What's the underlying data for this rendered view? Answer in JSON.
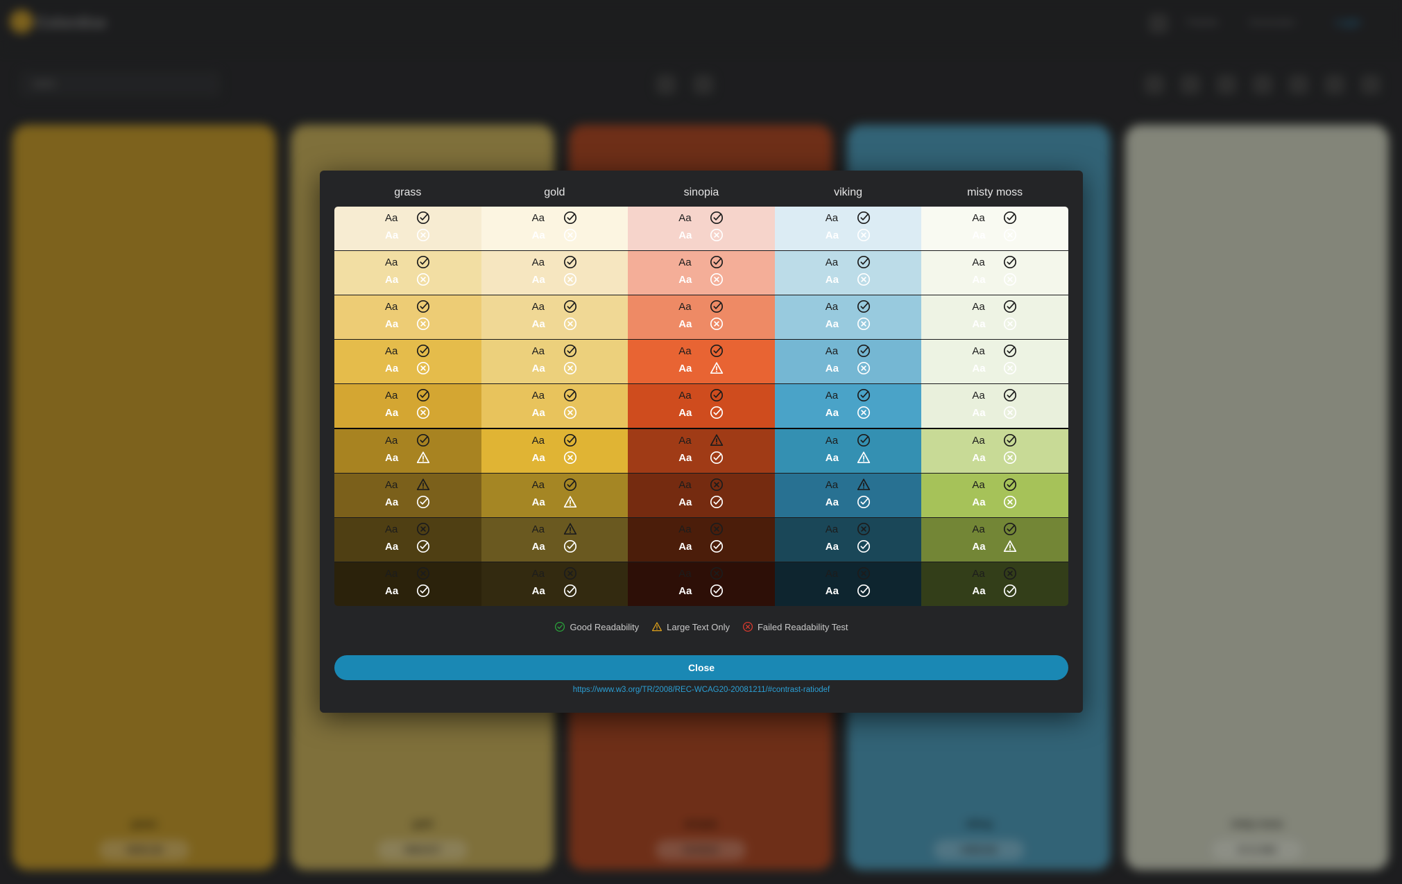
{
  "app": {
    "brand": "Colordise",
    "nav": [
      "Palette",
      "Generator",
      "Login"
    ],
    "search_value": "sans"
  },
  "palette_cards": [
    {
      "name": "grass",
      "hex": "#B8912B",
      "color": "#b8912b"
    },
    {
      "name": "gold",
      "hex": "#BBA557",
      "color": "#bba557"
    },
    {
      "name": "sinopia",
      "hex": "#A34624",
      "color": "#a34624"
    },
    {
      "name": "viking",
      "hex": "#4B92AE",
      "color": "#4b92ae"
    },
    {
      "name": "misty moss",
      "hex": "#C1C4B3",
      "color": "#c1c4b3"
    }
  ],
  "contrast_modal": {
    "columns": [
      "grass",
      "gold",
      "sinopia",
      "viking",
      "misty moss"
    ],
    "sample_text": "Aa",
    "dark_text_color": "#1c1c1c",
    "light_text_color": "#ffffff",
    "shades": [
      [
        "#f7ecd2",
        "#fcf5e1",
        "#f6d4cb",
        "#dcecf4",
        "#f9faf2"
      ],
      [
        "#f2dea3",
        "#f6e6c0",
        "#f4ae98",
        "#bcdce8",
        "#f4f7eb"
      ],
      [
        "#edcc75",
        "#f0d895",
        "#ee8a65",
        "#98cade",
        "#eef3e4"
      ],
      [
        "#e5bc4b",
        "#ecd07c",
        "#e86433",
        "#75b7d3",
        "#edf3e3"
      ],
      [
        "#d4a632",
        "#e8c35c",
        "#cf4c1e",
        "#4aa3c8",
        "#e9f0dc"
      ],
      [
        "#a88321",
        "#e0b434",
        "#a03b16",
        "#3490b2",
        "#c8da96"
      ],
      [
        "#7b601b",
        "#a58624",
        "#752b10",
        "#287192",
        "#a6c259"
      ],
      [
        "#4f3f13",
        "#6a5920",
        "#4b1d0a",
        "#1a4758",
        "#738636"
      ],
      [
        "#2b220b",
        "#332a10",
        "#2d0f07",
        "#0e252f",
        "#333e19"
      ]
    ],
    "dark_results": [
      [
        "pass",
        "pass",
        "pass",
        "pass",
        "pass"
      ],
      [
        "pass",
        "pass",
        "pass",
        "pass",
        "pass"
      ],
      [
        "pass",
        "pass",
        "pass",
        "pass",
        "pass"
      ],
      [
        "pass",
        "pass",
        "pass",
        "pass",
        "pass"
      ],
      [
        "pass",
        "pass",
        "pass",
        "pass",
        "pass"
      ],
      [
        "pass",
        "pass",
        "large",
        "pass",
        "pass"
      ],
      [
        "large",
        "pass",
        "fail",
        "large",
        "pass"
      ],
      [
        "fail",
        "large",
        "fail",
        "fail",
        "pass"
      ],
      [
        "fail",
        "fail",
        "fail",
        "fail",
        "fail"
      ]
    ],
    "light_results": [
      [
        "fail",
        "fail",
        "fail",
        "fail",
        "fail"
      ],
      [
        "fail",
        "fail",
        "fail",
        "fail",
        "fail"
      ],
      [
        "fail",
        "fail",
        "fail",
        "fail",
        "fail"
      ],
      [
        "fail",
        "fail",
        "large",
        "fail",
        "fail"
      ],
      [
        "fail",
        "fail",
        "pass",
        "fail",
        "fail"
      ],
      [
        "large",
        "fail",
        "pass",
        "large",
        "fail"
      ],
      [
        "pass",
        "large",
        "pass",
        "pass",
        "fail"
      ],
      [
        "pass",
        "pass",
        "pass",
        "pass",
        "large"
      ],
      [
        "pass",
        "pass",
        "pass",
        "pass",
        "pass"
      ]
    ],
    "legend": {
      "good": "Good Readability",
      "large": "Large Text Only",
      "failed": "Failed Readability Test"
    },
    "legend_colors": {
      "good": "#2aa33b",
      "large": "#e0a21a",
      "failed": "#d83a2e"
    },
    "close_label": "Close",
    "reference_url": "https://www.w3.org/TR/2008/REC-WCAG20-20081211/#contrast-ratiodef"
  }
}
